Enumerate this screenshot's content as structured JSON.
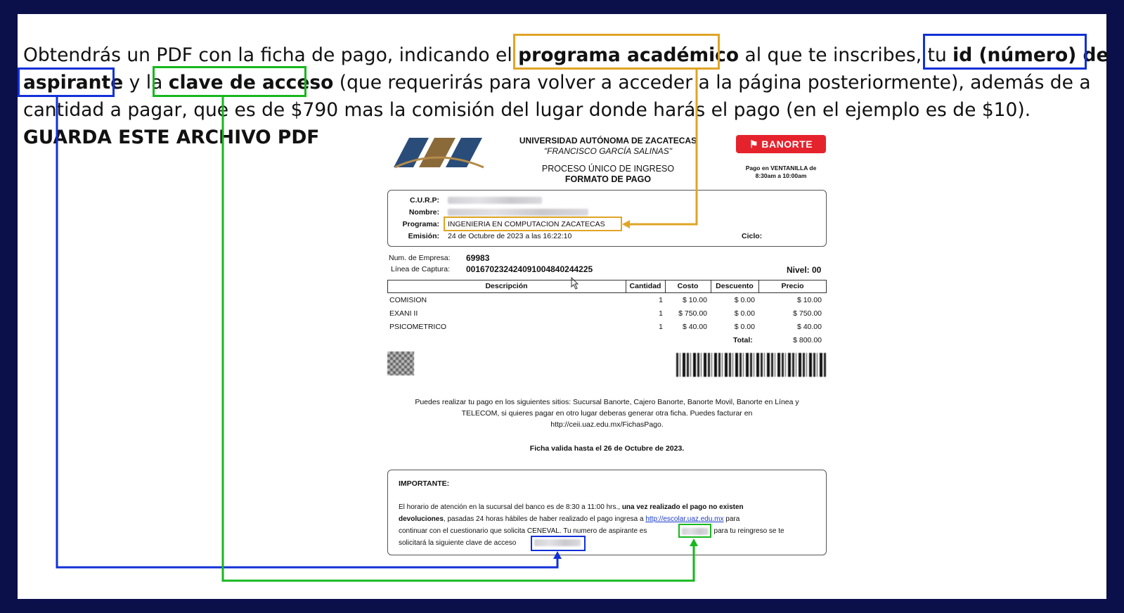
{
  "intro": {
    "l1a": "Obtendrás un PDF con la ficha de pago, indicando el ",
    "l1b": "programa académico",
    "l1c": " al que te inscribes, tu ",
    "l1d": "id (número) de",
    "l2a": "aspirante",
    "l2b": " y la ",
    "l2c": "clave de acceso",
    "l2d": " (que requerirás para volver a acceder a la página posteriormente), además de a",
    "l3": "cantidad a pagar, que es de $790 mas la comisión del lugar donde harás el pago (en el ejemplo es de $10).",
    "l4": "GUARDA ESTE ARCHIVO PDF"
  },
  "doc": {
    "logo_text": "UAZ",
    "university": "UNIVERSIDAD AUTÓNOMA DE ZACATECAS",
    "motto": "\"FRANCISCO GARCÍA SALINAS\"",
    "process": "PROCESO ÚNICO DE INGRESO",
    "format": "FORMATO DE PAGO",
    "bank": "BANORTE",
    "bank_hours_1": "Pago en VENTANILLA de",
    "bank_hours_2": "8:30am a 10:00am",
    "curp_label": "C.U.R.P:",
    "nombre_label": "Nombre:",
    "programa_label": "Programa:",
    "programa_value": "INGENIERIA EN COMPUTACION ZACATECAS",
    "emision_label": "Emisión:",
    "emision_value": "24 de Octubre de 2023 a las 16:22:10",
    "ciclo_label": "Ciclo:",
    "empresa_label": "Num. de Empresa:",
    "empresa_value": "69983",
    "captura_label": "Línea de Captura:",
    "captura_value": "0016702324240910048402442​25",
    "nivel": "Nivel: 00",
    "headers": [
      "Descripción",
      "Cantidad",
      "Costo",
      "Descuento",
      "Precio"
    ],
    "rows": [
      {
        "desc": "COMISION",
        "qty": "1",
        "cost": "$ 10.00",
        "disc": "$ 0.00",
        "price": "$ 10.00"
      },
      {
        "desc": "EXANI II",
        "qty": "1",
        "cost": "$ 750.00",
        "disc": "$ 0.00",
        "price": "$ 750.00"
      },
      {
        "desc": "PSICOMETRICO",
        "qty": "1",
        "cost": "$ 40.00",
        "disc": "$ 0.00",
        "price": "$ 40.00"
      }
    ],
    "total_label": "Total:",
    "total_value": "$ 800.00",
    "places_1": "Puedes realizar tu pago en los siguientes sitios: Sucursal Banorte, Cajero Banorte, Banorte Movil, Banorte en Línea y",
    "places_2": "TELECOM, si quieres pagar en otro lugar deberas generar otra ficha. Puedes facturar en",
    "places_3": "http://ceii.uaz.edu.mx/FichasPago.",
    "valid": "Ficha valida hasta el 26 de Octubre de 2023.",
    "important_title": "IMPORTANTE:",
    "imp1a": "El horario de atención en la sucursal del banco es de 8:30 a 11:00 hrs., ",
    "imp1b": "una vez realizado el pago no existen",
    "imp2a": "devoluciones",
    "imp2b": ", pasadas 24 horas hábiles de haber realizado el pago ingresa a ",
    "imp2link": "http://escolar.uaz.edu.mx",
    "imp2c": " para",
    "imp3a": "continuar con el cuestionario que solicita CENEVAL. Tu numero de aspirante es",
    "imp3b": ", para tu reingreso se te",
    "imp4a": "solicitará la siguiente clave de acceso"
  },
  "colors": {
    "orange": "#e0a526",
    "blue": "#1230d8",
    "green": "#16b81d",
    "banorte": "#e5232d",
    "border": "#0b0f4a"
  }
}
